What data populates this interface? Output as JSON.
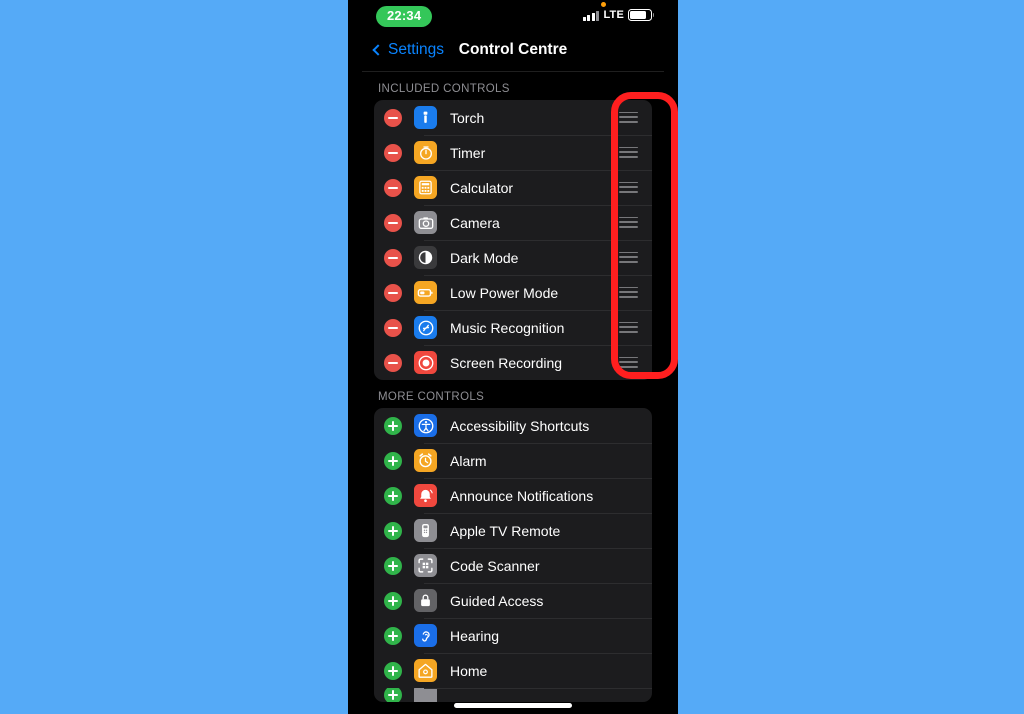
{
  "background_color": "#55aaf7",
  "status_bar": {
    "time": "22:34",
    "time_pill_color": "#34c759",
    "mic_indicator": "orange-dot",
    "network_label": "LTE",
    "signal_icon": "signal-bars-icon",
    "battery_icon": "battery-icon"
  },
  "nav_bar": {
    "back_label": "Settings",
    "back_icon": "chevron-left-icon",
    "title": "Control Centre",
    "accent_color": "#0a84ff"
  },
  "sections": [
    {
      "header": "INCLUDED CONTROLS",
      "action": "remove",
      "action_color": "#e8524a",
      "has_drag_handles": true,
      "items": [
        {
          "label": "Torch",
          "icon": "torch-icon",
          "icon_bg": "#1a7ced"
        },
        {
          "label": "Timer",
          "icon": "timer-icon",
          "icon_bg": "#f5a623"
        },
        {
          "label": "Calculator",
          "icon": "calculator-icon",
          "icon_bg": "#f5a623"
        },
        {
          "label": "Camera",
          "icon": "camera-icon",
          "icon_bg": "#8e8e93"
        },
        {
          "label": "Dark Mode",
          "icon": "dark-mode-icon",
          "icon_bg": "#3a3a3c"
        },
        {
          "label": "Low Power Mode",
          "icon": "low-power-mode-icon",
          "icon_bg": "#f5a623"
        },
        {
          "label": "Music Recognition",
          "icon": "shazam-icon",
          "icon_bg": "#1a7ced"
        },
        {
          "label": "Screen Recording",
          "icon": "screen-recording-icon",
          "icon_bg": "#f0483e"
        }
      ]
    },
    {
      "header": "MORE CONTROLS",
      "action": "add",
      "action_color": "#30b44a",
      "has_drag_handles": false,
      "items": [
        {
          "label": "Accessibility Shortcuts",
          "icon": "accessibility-icon",
          "icon_bg": "#1a6ee8"
        },
        {
          "label": "Alarm",
          "icon": "alarm-icon",
          "icon_bg": "#f5a623"
        },
        {
          "label": "Announce Notifications",
          "icon": "announce-notifications-icon",
          "icon_bg": "#f0483e"
        },
        {
          "label": "Apple TV Remote",
          "icon": "apple-tv-remote-icon",
          "icon_bg": "#8e8e93"
        },
        {
          "label": "Code Scanner",
          "icon": "code-scanner-icon",
          "icon_bg": "#8e8e93"
        },
        {
          "label": "Guided Access",
          "icon": "guided-access-icon",
          "icon_bg": "#636366"
        },
        {
          "label": "Hearing",
          "icon": "hearing-icon",
          "icon_bg": "#1a6ee8"
        },
        {
          "label": "Home",
          "icon": "home-icon",
          "icon_bg": "#f5a623"
        }
      ]
    }
  ],
  "annotation": {
    "type": "red-rounded-rectangle-highlight",
    "color": "#ff1f1f",
    "target": "drag-handles-column"
  },
  "home_indicator": "home-indicator-bar"
}
